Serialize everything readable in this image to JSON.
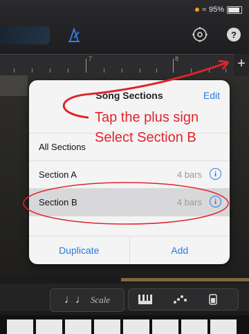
{
  "status": {
    "battery_text": "95%"
  },
  "toolbar": {
    "metronome_icon": "metronome-icon",
    "settings_icon": "gear-icon",
    "help_label": "?"
  },
  "ruler": {
    "marks": [
      "7",
      "8"
    ],
    "add_label": "+"
  },
  "popover": {
    "title": "Song Sections",
    "edit_label": "Edit",
    "rows": [
      {
        "label": "All Sections",
        "meta": ""
      },
      {
        "label": "Section A",
        "meta": "4 bars"
      },
      {
        "label": "Section B",
        "meta": "4 bars"
      }
    ],
    "footer": {
      "duplicate_label": "Duplicate",
      "add_label": "Add"
    }
  },
  "annotations": {
    "line1": "Tap the plus sign",
    "line2": "Select Section B"
  },
  "controls": {
    "scale_label": "Scale",
    "notes_glyph": "♩♩"
  },
  "colors": {
    "annotation": "#e0242a",
    "accent": "#2a7ae0"
  }
}
